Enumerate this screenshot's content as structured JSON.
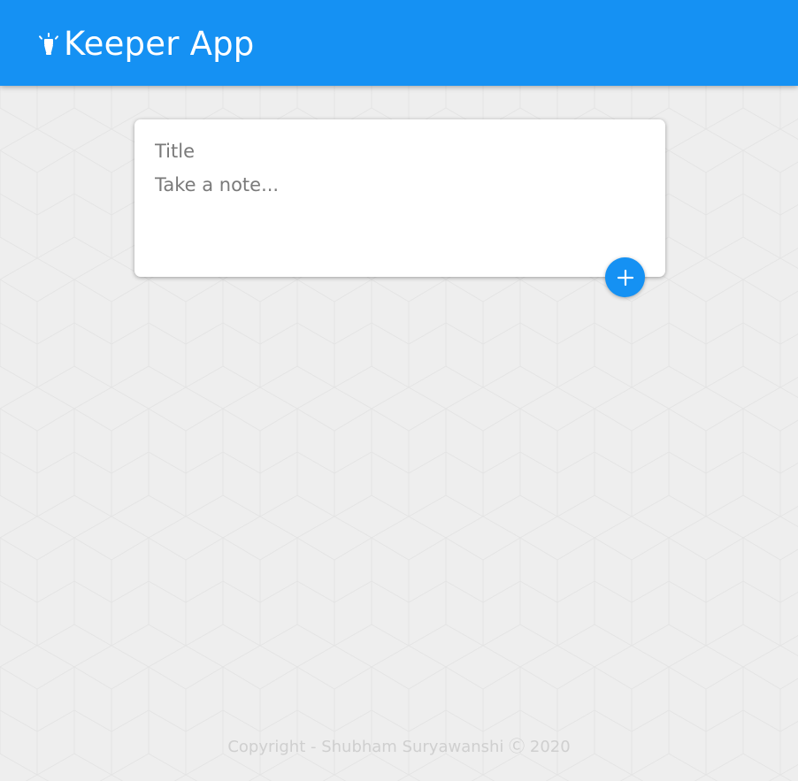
{
  "header": {
    "app_name": "Keeper App",
    "logo_icon": "lamp-icon",
    "background_color": "#1591f3"
  },
  "note_form": {
    "title_placeholder": "Title",
    "content_placeholder": "Take a note...",
    "title_value": "",
    "content_value": "",
    "add_button_icon": "add-icon"
  },
  "footer": {
    "copyright": "Copyright - Shubham Suryawanshi Ⓒ 2020"
  },
  "colors": {
    "accent": "#1591f3",
    "background": "#eeeeee",
    "footer_text": "#cfcfcf"
  }
}
